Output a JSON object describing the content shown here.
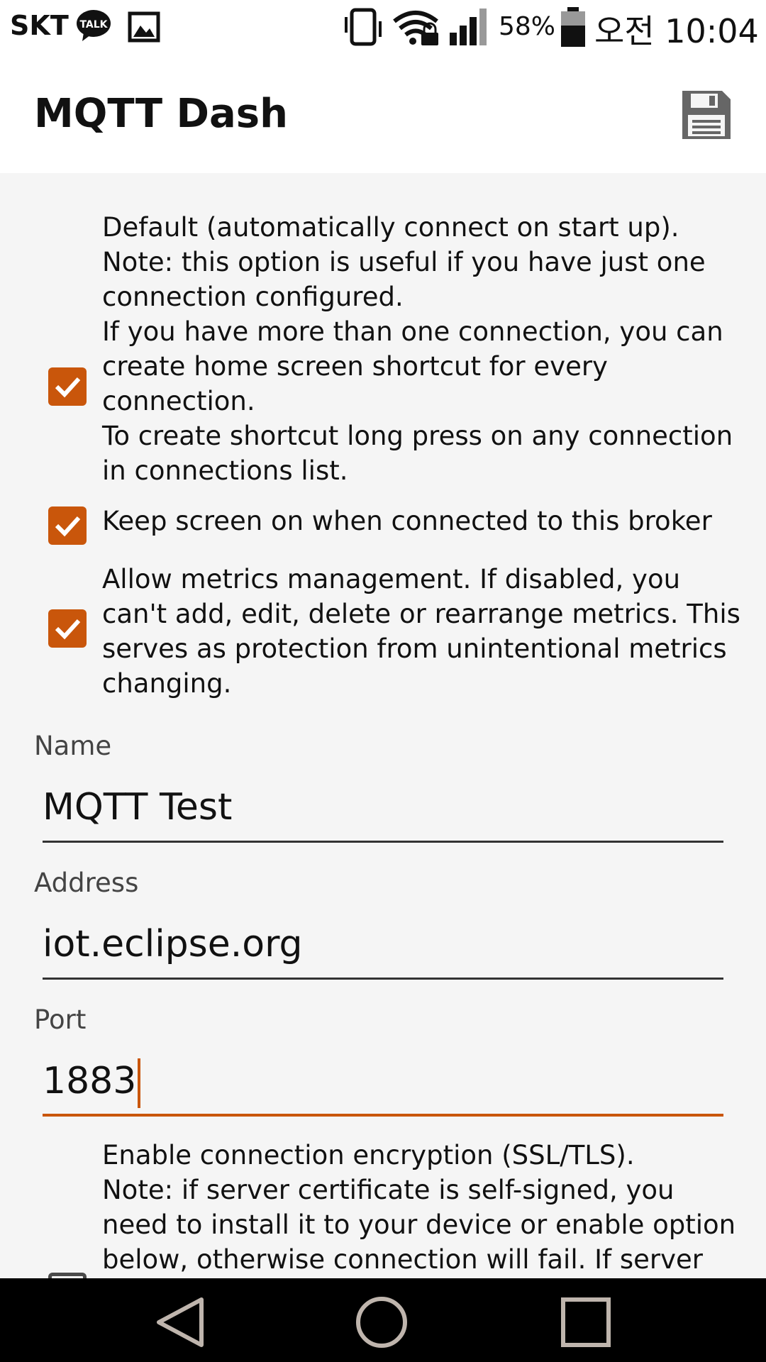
{
  "status_bar": {
    "carrier": "SKT",
    "battery_percent": "58%",
    "time": "오전 10:04",
    "icons": [
      "kakaotalk-icon",
      "gallery-icon",
      "vibrate-icon",
      "wifi-lock-icon",
      "signal-icon",
      "battery-icon"
    ]
  },
  "app_bar": {
    "title": "MQTT Dash",
    "save_icon": "floppy-disk-icon"
  },
  "options": [
    {
      "text": "Default (automatically connect on start up).\nNote: this option is useful if you have just one connection configured.\nIf you have more than one connection, you can create home screen shortcut for every connection.\nTo create shortcut long press on any connection in connections list.",
      "checked": true
    },
    {
      "text": "Keep screen on when connected to this broker",
      "checked": true
    },
    {
      "text": "Allow metrics management. If disabled, you can't add, edit, delete or rearrange metrics. This serves as protection from unintentional metrics changing.",
      "checked": true
    }
  ],
  "fields": {
    "name": {
      "label": "Name",
      "value": "MQTT Test"
    },
    "address": {
      "label": "Address",
      "value": "iot.eclipse.org"
    },
    "port": {
      "label": "Port",
      "value": "1883"
    }
  },
  "ssl_option": {
    "text": "Enable connection encryption (SSL/TLS).\nNote: if server certificate is self-signed, you need to install it to your device or enable option below, otherwise connection will fail. If server",
    "checked": false
  },
  "nav_bar": {
    "icons": [
      "back-icon",
      "home-icon",
      "recents-icon"
    ]
  },
  "colors": {
    "accent": "#c9560b",
    "background": "#f5f5f5",
    "app_bar": "#ffffff",
    "nav_bar": "#000000"
  }
}
